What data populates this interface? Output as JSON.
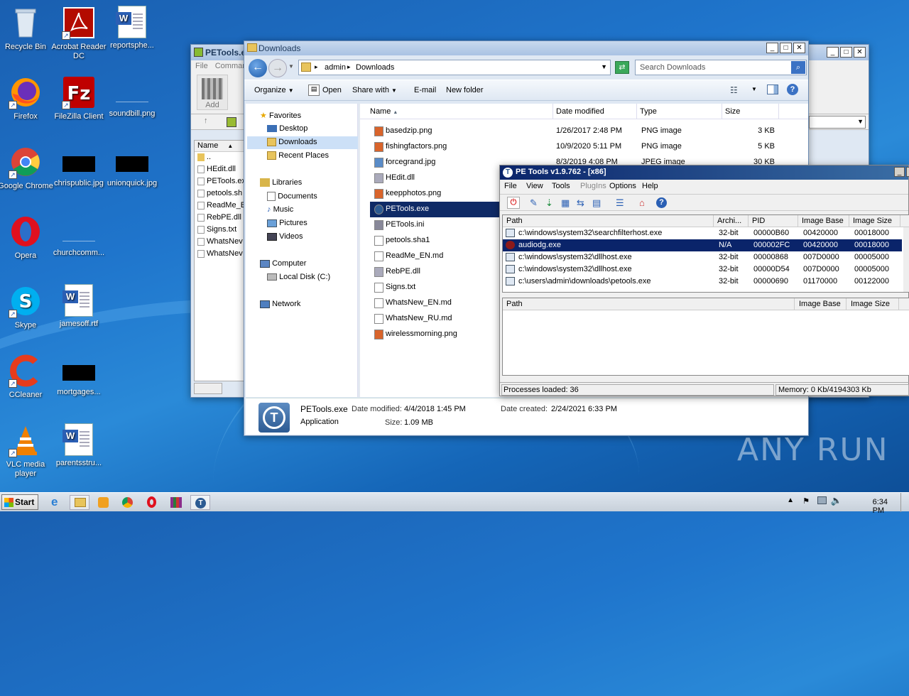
{
  "desktop": {
    "icons": [
      {
        "label": "Recycle Bin"
      },
      {
        "label": "Acrobat Reader DC"
      },
      {
        "label": "reportsphe..."
      },
      {
        "label": "Firefox"
      },
      {
        "label": "FileZilla Client"
      },
      {
        "label": "soundbill.png"
      },
      {
        "label": "Google Chrome"
      },
      {
        "label": "chrispublic.jpg"
      },
      {
        "label": "unionquick.jpg"
      },
      {
        "label": "Opera"
      },
      {
        "label": "churchcomm..."
      },
      {
        "label": "Skype"
      },
      {
        "label": "jamesoff.rtf"
      },
      {
        "label": "CCleaner"
      },
      {
        "label": "mortgages..."
      },
      {
        "label": "VLC media player"
      },
      {
        "label": "parentsstru..."
      }
    ]
  },
  "back_window": {
    "title": "PETools.e",
    "menu": [
      "File",
      "Commar"
    ],
    "toolbar_add": "Add",
    "name_header": "Name",
    "files": [
      "..",
      "HEdit.dll",
      "PETools.ex",
      "petools.sh",
      "ReadMe_E",
      "RebPE.dll",
      "Signs.txt",
      "WhatsNev",
      "WhatsNev"
    ]
  },
  "explorer": {
    "title": "Downloads",
    "breadcrumb": [
      "admin",
      "Downloads"
    ],
    "search_placeholder": "Search Downloads",
    "toolbar": [
      "Organize",
      "Open",
      "Share with",
      "E-mail",
      "New folder"
    ],
    "nav": {
      "favorites_header": "Favorites",
      "favorites": [
        "Desktop",
        "Downloads",
        "Recent Places"
      ],
      "libraries_header": "Libraries",
      "libraries": [
        "Documents",
        "Music",
        "Pictures",
        "Videos"
      ],
      "computer_header": "Computer",
      "computer": [
        "Local Disk (C:)"
      ],
      "network": "Network"
    },
    "columns": [
      "Name",
      "Date modified",
      "Type",
      "Size"
    ],
    "files": [
      {
        "name": "basedzip.png",
        "date": "1/26/2017 2:48 PM",
        "type": "PNG image",
        "size": "3 KB"
      },
      {
        "name": "fishingfactors.png",
        "date": "10/9/2020 5:11 PM",
        "type": "PNG image",
        "size": "5 KB"
      },
      {
        "name": "forcegrand.jpg",
        "date": "8/3/2019 4:08 PM",
        "type": "JPEG image",
        "size": "30 KB"
      },
      {
        "name": "HEdit.dll",
        "date": "",
        "type": "",
        "size": ""
      },
      {
        "name": "keepphotos.png",
        "date": "",
        "type": "",
        "size": ""
      },
      {
        "name": "PETools.exe",
        "date": "",
        "type": "",
        "size": ""
      },
      {
        "name": "PETools.ini",
        "date": "",
        "type": "",
        "size": ""
      },
      {
        "name": "petools.sha1",
        "date": "",
        "type": "",
        "size": ""
      },
      {
        "name": "ReadMe_EN.md",
        "date": "",
        "type": "",
        "size": ""
      },
      {
        "name": "RebPE.dll",
        "date": "",
        "type": "",
        "size": ""
      },
      {
        "name": "Signs.txt",
        "date": "",
        "type": "",
        "size": ""
      },
      {
        "name": "WhatsNew_EN.md",
        "date": "",
        "type": "",
        "size": ""
      },
      {
        "name": "WhatsNew_RU.md",
        "date": "",
        "type": "",
        "size": ""
      },
      {
        "name": "wirelessmorning.png",
        "date": "",
        "type": "",
        "size": ""
      }
    ],
    "details": {
      "name": "PETools.exe",
      "type": "Application",
      "date_modified_label": "Date modified:",
      "date_modified": "4/4/2018 1:45 PM",
      "size_label": "Size:",
      "size": "1.09 MB",
      "date_created_label": "Date created:",
      "date_created": "2/24/2021 6:33 PM"
    }
  },
  "petools": {
    "title": "PE Tools v1.9.762 - [x86]",
    "menu": [
      "File",
      "View",
      "Tools",
      "PlugIns",
      "Options",
      "Help"
    ],
    "proc_columns": [
      "Path",
      "Archi...",
      "PID",
      "Image Base",
      "Image Size"
    ],
    "processes": [
      {
        "path": "c:\\windows\\system32\\searchfilterhost.exe",
        "arch": "32-bit",
        "pid": "00000B60",
        "base": "00420000",
        "size": "00018000"
      },
      {
        "path": "audiodg.exe",
        "arch": "N/A",
        "pid": "000002FC",
        "base": "00420000",
        "size": "00018000"
      },
      {
        "path": "c:\\windows\\system32\\dllhost.exe",
        "arch": "32-bit",
        "pid": "00000868",
        "base": "007D0000",
        "size": "00005000"
      },
      {
        "path": "c:\\windows\\system32\\dllhost.exe",
        "arch": "32-bit",
        "pid": "00000D54",
        "base": "007D0000",
        "size": "00005000"
      },
      {
        "path": "c:\\users\\admin\\downloads\\petools.exe",
        "arch": "32-bit",
        "pid": "00000690",
        "base": "01170000",
        "size": "00122000"
      }
    ],
    "module_columns": [
      "Path",
      "Image Base",
      "Image Size"
    ],
    "status_left": "Processes loaded: 36",
    "status_right": "Memory: 0 Kb/4194303 Kb"
  },
  "taskbar": {
    "start": "Start",
    "time": "6:34 PM"
  },
  "watermark": "ANY RUN"
}
